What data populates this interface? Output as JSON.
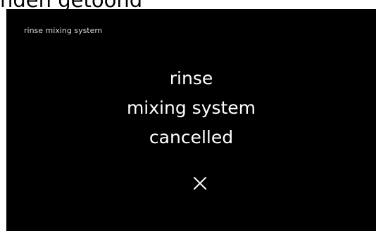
{
  "caption": {
    "text": "nden getoond"
  },
  "screen": {
    "header_title": "rinse mixing system",
    "message_lines": [
      "rinse",
      "mixing system",
      "cancelled"
    ],
    "status_icon": "close-x-icon",
    "colors": {
      "background": "#000000",
      "text": "#ffffff"
    }
  }
}
